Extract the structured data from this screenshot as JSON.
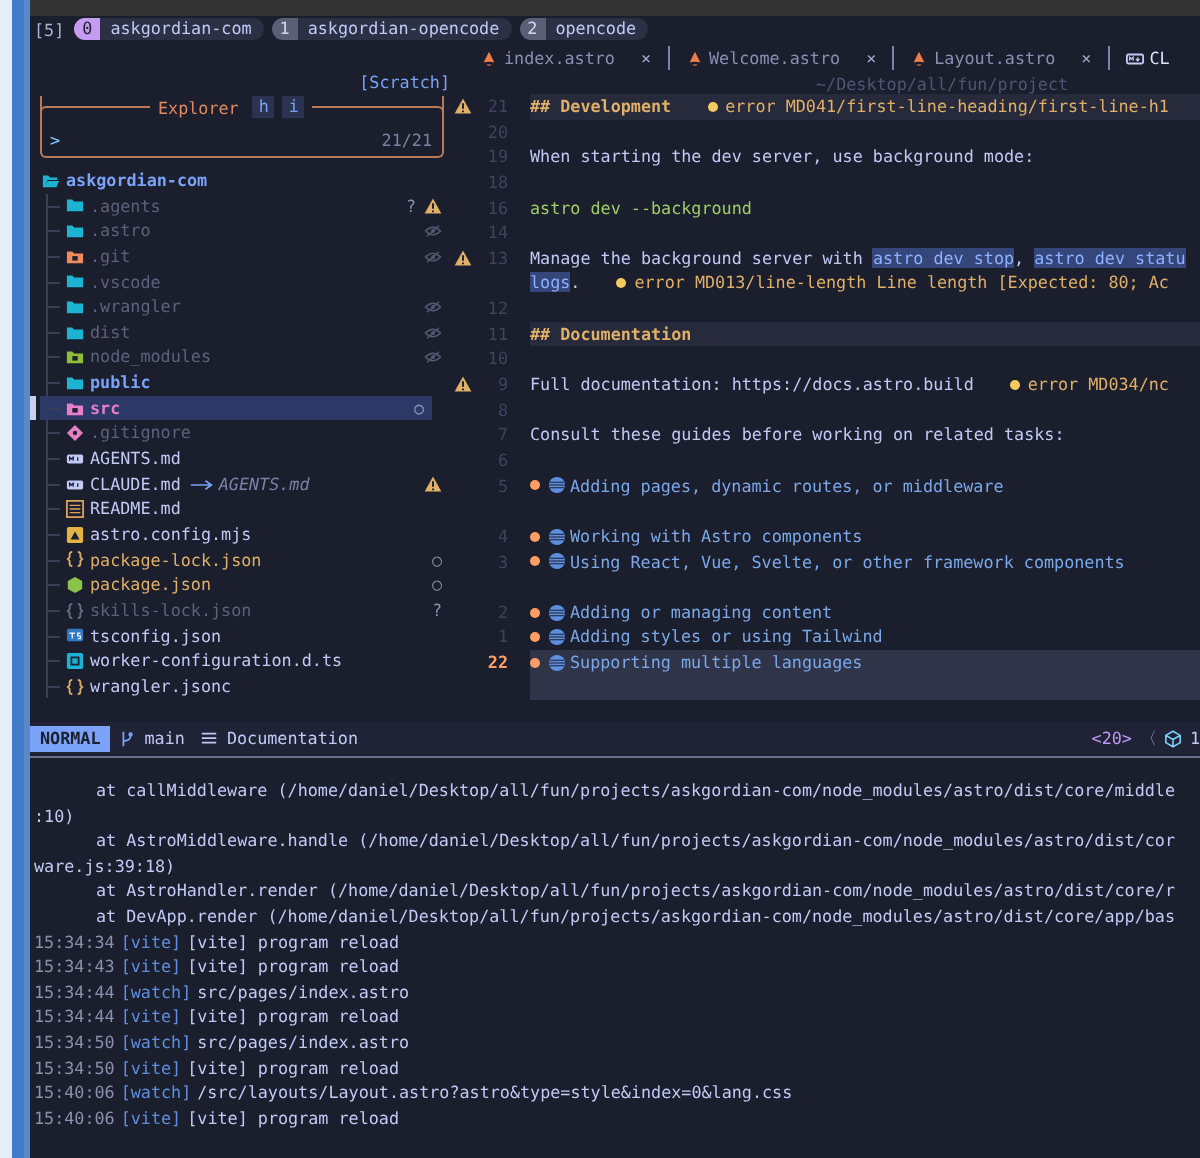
{
  "session_bar": {
    "count": "[5]",
    "windows": [
      {
        "index": "0",
        "name": "askgordian-com",
        "selected": true
      },
      {
        "index": "1",
        "name": "askgordian-opencode",
        "selected": false
      },
      {
        "index": "2",
        "name": "opencode",
        "selected": false
      }
    ]
  },
  "editor_tabs": [
    {
      "label": "index.astro",
      "kind": "astro",
      "close": "×",
      "selected": false
    },
    {
      "label": "Welcome.astro",
      "kind": "astro",
      "close": "×",
      "selected": false
    },
    {
      "label": "Layout.astro",
      "kind": "astro",
      "close": "×",
      "selected": false
    },
    {
      "label": "CL",
      "kind": "markdown",
      "selected": true
    }
  ],
  "explorer": {
    "scratch": "[Scratch]",
    "title": "Explorer",
    "keys": [
      "h",
      "i"
    ],
    "prompt": ">",
    "count": "21/21",
    "tree": [
      {
        "name": "askgordian-com",
        "kind": "open-folder",
        "expanded": true,
        "selected": false,
        "dimmed": false,
        "modified": false,
        "children": [
          {
            "name": ".agents",
            "kind": "folder",
            "status": "?",
            "selected": false,
            "dimmed": true,
            "modified": false,
            "hidden": false,
            "warning": true
          },
          {
            "name": ".astro",
            "kind": "folder",
            "selected": false,
            "dimmed": true,
            "modified": false,
            "hidden": true,
            "warning": false
          },
          {
            "name": ".git",
            "kind": "git-folder",
            "selected": false,
            "dimmed": true,
            "modified": false,
            "hidden": true,
            "warning": false
          },
          {
            "name": ".vscode",
            "kind": "folder",
            "selected": false,
            "dimmed": true,
            "modified": false,
            "hidden": false,
            "warning": false
          },
          {
            "name": ".wrangler",
            "kind": "folder",
            "selected": false,
            "dimmed": true,
            "modified": false,
            "hidden": true,
            "warning": false
          },
          {
            "name": "dist",
            "kind": "folder",
            "selected": false,
            "dimmed": true,
            "modified": false,
            "hidden": true,
            "warning": false
          },
          {
            "name": "node_modules",
            "kind": "modules-folder",
            "selected": false,
            "dimmed": true,
            "modified": false,
            "hidden": true,
            "warning": false
          },
          {
            "name": "public",
            "kind": "folder",
            "selected": false,
            "dimmed": false,
            "modified": false,
            "hidden": false,
            "warning": false
          },
          {
            "name": "src",
            "kind": "src-folder",
            "status": "○",
            "selected": true,
            "dimmed": false,
            "modified": false,
            "hidden": false,
            "warning": false
          },
          {
            "name": ".gitignore",
            "kind": "git-file",
            "selected": false,
            "dimmed": true,
            "modified": false,
            "hidden": false,
            "warning": false
          },
          {
            "name": "AGENTS.md",
            "kind": "markdown",
            "selected": false,
            "dimmed": false,
            "modified": false,
            "hidden": false,
            "warning": false
          },
          {
            "name": "CLAUDE.md",
            "kind": "markdown",
            "link_target": "AGENTS.md",
            "selected": false,
            "dimmed": false,
            "modified": false,
            "hidden": false,
            "warning": true
          },
          {
            "name": "README.md",
            "kind": "readme",
            "selected": false,
            "dimmed": false,
            "modified": false,
            "hidden": false,
            "warning": false
          },
          {
            "name": "astro.config.mjs",
            "kind": "config",
            "selected": false,
            "dimmed": false,
            "modified": false,
            "hidden": false,
            "warning": false
          },
          {
            "name": "package-lock.json",
            "kind": "json",
            "status": "○",
            "selected": false,
            "dimmed": false,
            "modified": true,
            "hidden": false,
            "warning": false
          },
          {
            "name": "package.json",
            "kind": "package",
            "status": "○",
            "selected": false,
            "dimmed": false,
            "modified": true,
            "hidden": false,
            "warning": false
          },
          {
            "name": "skills-lock.json",
            "kind": "json",
            "status": "?",
            "selected": false,
            "dimmed": true,
            "modified": false,
            "hidden": false,
            "warning": false
          },
          {
            "name": "tsconfig.json",
            "kind": "typescript",
            "selected": false,
            "dimmed": false,
            "modified": false,
            "hidden": false,
            "warning": false
          },
          {
            "name": "worker-configuration.d.ts",
            "kind": "declaration",
            "selected": false,
            "dimmed": false,
            "modified": false,
            "hidden": false,
            "warning": false
          },
          {
            "name": "wrangler.jsonc",
            "kind": "json",
            "selected": false,
            "dimmed": false,
            "modified": false,
            "hidden": false,
            "warning": false
          }
        ]
      }
    ]
  },
  "editor": {
    "path": "~/Desktop/all/fun/project",
    "lines": [
      {
        "num": "21",
        "kind": "heading",
        "text": "## Development",
        "diagnostic": "error MD041/first-line-heading/first-line-h1",
        "warning": true,
        "current": false
      },
      {
        "num": "20",
        "kind": "blank",
        "warning": false,
        "current": false
      },
      {
        "num": "19",
        "kind": "text",
        "parts": [
          {
            "text": "When starting the dev server, use background mode:",
            "code": false
          }
        ],
        "warning": false,
        "current": false
      },
      {
        "num": "18",
        "kind": "blank",
        "warning": false,
        "current": false
      },
      {
        "num": "16",
        "kind": "code",
        "text": "astro dev --background",
        "warning": false,
        "current": false
      },
      {
        "num": "14",
        "kind": "blank",
        "warning": false,
        "current": false
      },
      {
        "num": "13",
        "kind": "text",
        "parts": [
          {
            "text": "Manage the background server with ",
            "code": false
          },
          {
            "text": "astro dev stop",
            "code": true
          },
          {
            "text": ", ",
            "code": false
          },
          {
            "text": "astro dev statu",
            "code": true
          }
        ],
        "warning": true,
        "current": false
      },
      {
        "kind": "text",
        "parts": [
          {
            "text": "logs",
            "code": true
          },
          {
            "text": ".",
            "code": false
          }
        ],
        "diagnostic": "error MD013/line-length Line length [Expected: 80; Ac",
        "warning": false,
        "current": false
      },
      {
        "num": "12",
        "kind": "blank",
        "warning": false,
        "current": false
      },
      {
        "num": "11",
        "kind": "heading",
        "text": "## Documentation",
        "warning": false,
        "current": false
      },
      {
        "num": "10",
        "kind": "blank",
        "warning": false,
        "current": false
      },
      {
        "num": "9",
        "kind": "text",
        "parts": [
          {
            "text": "Full documentation: https://docs.astro.build",
            "code": false
          }
        ],
        "diagnostic": "error MD034/nc",
        "warning": true,
        "current": false
      },
      {
        "num": "8",
        "kind": "blank",
        "warning": false,
        "current": false
      },
      {
        "num": "7",
        "kind": "text",
        "parts": [
          {
            "text": "Consult these guides before working on related tasks:",
            "code": false
          }
        ],
        "warning": false,
        "current": false
      },
      {
        "num": "6",
        "kind": "blank",
        "warning": false,
        "current": false
      },
      {
        "num": "5",
        "kind": "bullet",
        "text": "Adding pages, dynamic routes, or middleware",
        "warning": false,
        "current": false
      },
      {
        "kind": "blank",
        "warning": false,
        "current": false
      },
      {
        "num": "4",
        "kind": "bullet",
        "text": "Working with Astro components",
        "warning": false,
        "current": false
      },
      {
        "num": "3",
        "kind": "bullet",
        "text": "Using React, Vue, Svelte, or other framework components",
        "warning": false,
        "current": false
      },
      {
        "kind": "blank",
        "warning": false,
        "current": false
      },
      {
        "num": "2",
        "kind": "bullet",
        "text": "Adding or managing content",
        "warning": false,
        "current": false
      },
      {
        "num": "1",
        "kind": "bullet",
        "text": "Adding styles or using Tailwind",
        "warning": false,
        "current": false
      },
      {
        "num": "22",
        "kind": "bullet",
        "text": "Supporting multiple languages",
        "warning": false,
        "current": true
      },
      {
        "kind": "blank",
        "warning": false,
        "current": true
      }
    ]
  },
  "status_line": {
    "mode": "NORMAL",
    "branch": "main",
    "section": "Documentation",
    "position": "<20>",
    "separator": "〈",
    "count": "1"
  },
  "terminal": {
    "lines": [
      {
        "kind": "trace",
        "text": "at callMiddleware (/home/daniel/Desktop/all/fun/projects/askgordian-com/node_modules/astro/dist/core/middle"
      },
      {
        "kind": "plain",
        "text": ":10)"
      },
      {
        "kind": "trace",
        "text": "at AstroMiddleware.handle (/home/daniel/Desktop/all/fun/projects/askgordian-com/node_modules/astro/dist/cor"
      },
      {
        "kind": "plain",
        "text": "ware.js:39:18)"
      },
      {
        "kind": "trace",
        "text": "at AstroHandler.render (/home/daniel/Desktop/all/fun/projects/askgordian-com/node_modules/astro/dist/core/r"
      },
      {
        "kind": "trace",
        "text": "at DevApp.render (/home/daniel/Desktop/all/fun/projects/askgordian-com/node_modules/astro/dist/core/app/bas"
      },
      {
        "kind": "log",
        "time": "15:34:34",
        "tag": "[vite]",
        "text": "[vite] program reload"
      },
      {
        "kind": "log",
        "time": "15:34:43",
        "tag": "[vite]",
        "text": "[vite] program reload"
      },
      {
        "kind": "log",
        "time": "15:34:44",
        "tag": "[watch]",
        "text": "src/pages/index.astro"
      },
      {
        "kind": "log",
        "time": "15:34:44",
        "tag": "[vite]",
        "text": "[vite] program reload"
      },
      {
        "kind": "log",
        "time": "15:34:50",
        "tag": "[watch]",
        "text": "src/pages/index.astro"
      },
      {
        "kind": "log",
        "time": "15:34:50",
        "tag": "[vite]",
        "text": "[vite] program reload"
      },
      {
        "kind": "log",
        "time": "15:40:06",
        "tag": "[watch]",
        "text": "/src/layouts/Layout.astro?astro&type=style&index=0&lang.css"
      },
      {
        "kind": "log",
        "time": "15:40:06",
        "tag": "[vite]",
        "text": "[vite] program reload"
      }
    ]
  }
}
